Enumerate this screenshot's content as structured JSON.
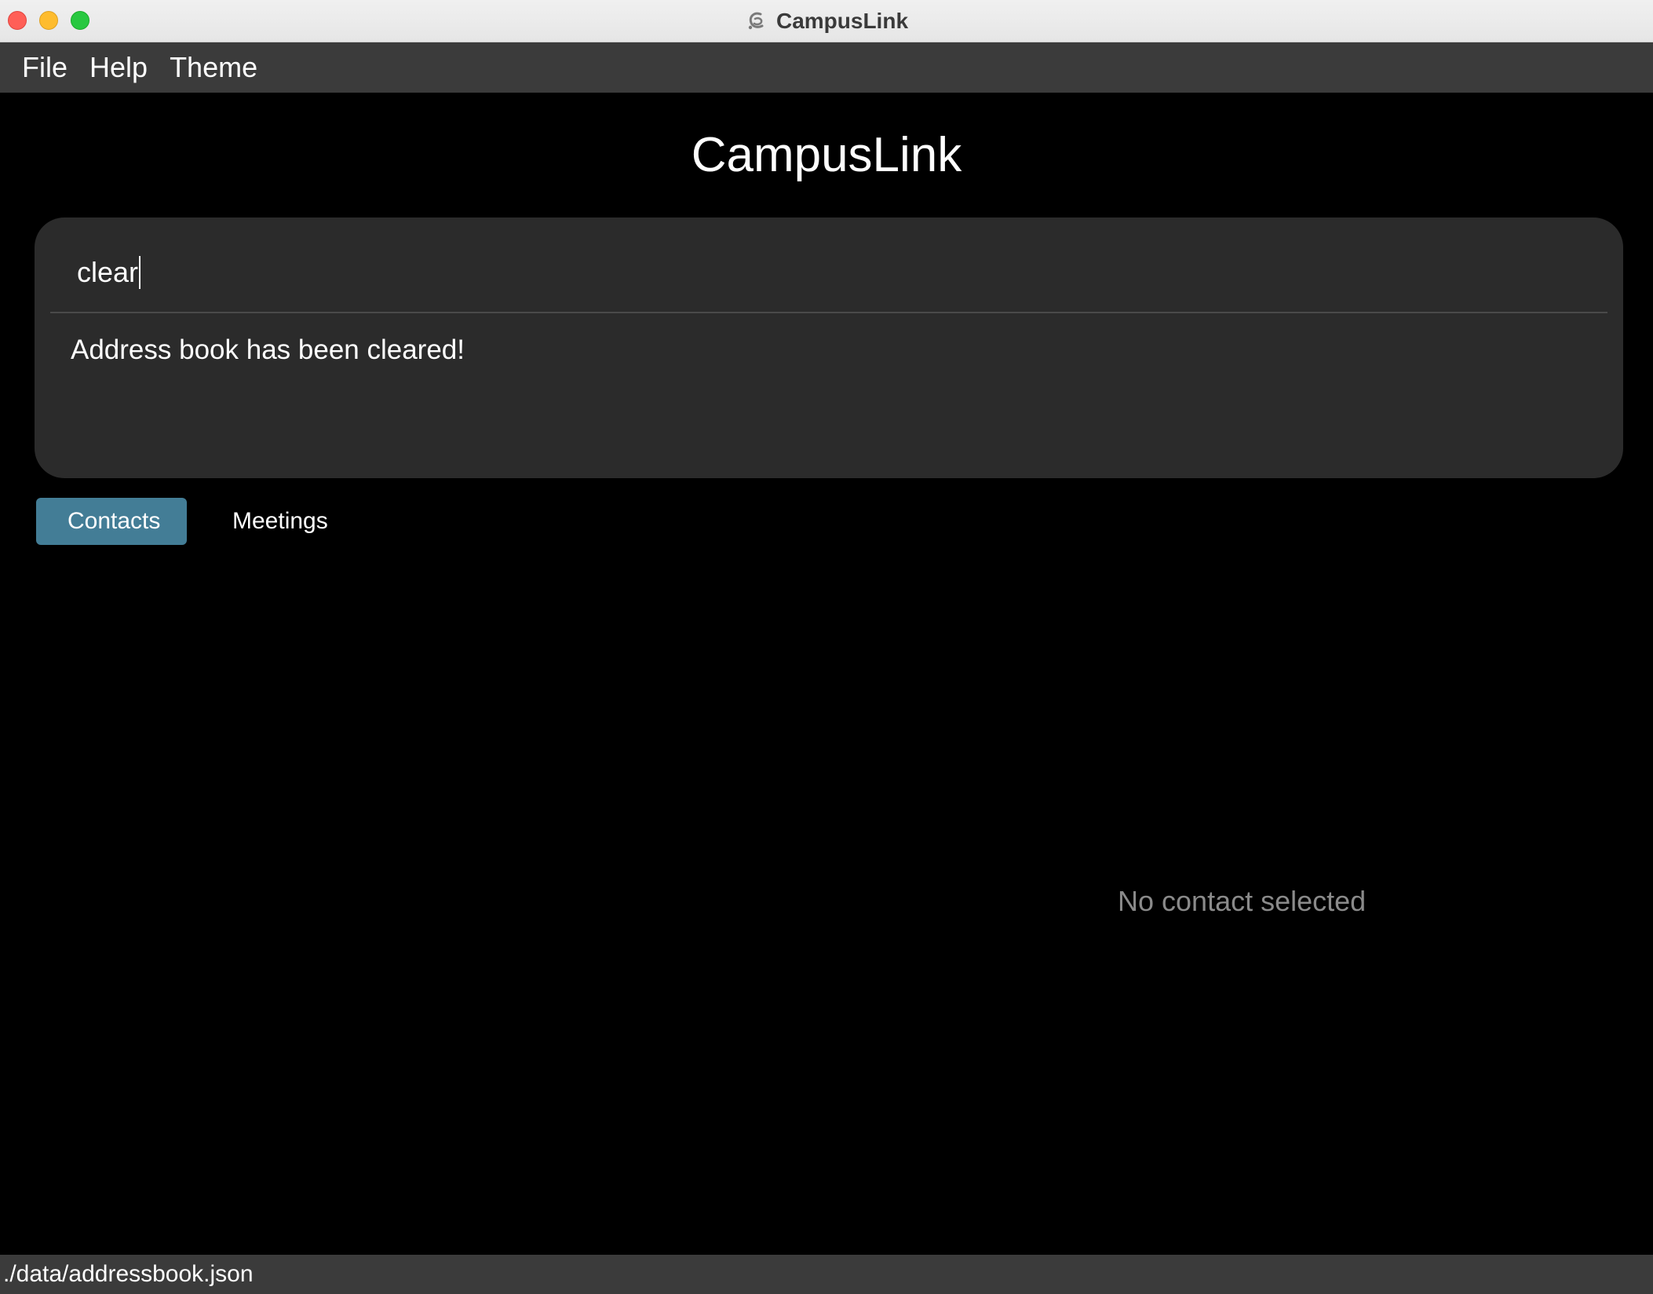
{
  "window": {
    "title": "CampusLink",
    "app_icon": "campuslink-app-icon"
  },
  "menu": {
    "items": [
      {
        "label": "File"
      },
      {
        "label": "Help"
      },
      {
        "label": "Theme"
      }
    ]
  },
  "main": {
    "heading": "CampusLink"
  },
  "command": {
    "input_value": "clear",
    "result_message": "Address book has been cleared!"
  },
  "tabs": [
    {
      "label": "Contacts",
      "active": true
    },
    {
      "label": "Meetings",
      "active": false
    }
  ],
  "detail": {
    "empty_message": "No contact selected"
  },
  "status": {
    "file_path": "./data/addressbook.json"
  },
  "colors": {
    "background": "#000000",
    "panel": "#2b2b2b",
    "menubar": "#3b3b3b",
    "tab_active": "#437d96",
    "muted_text": "#8a8a8a"
  }
}
